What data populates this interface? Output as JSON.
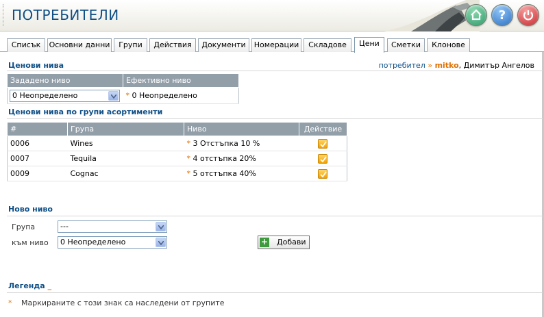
{
  "header": {
    "title": "ПОТРЕБИТЕЛИ",
    "buttons": [
      {
        "name": "home-icon"
      },
      {
        "name": "help-icon"
      },
      {
        "name": "power-icon"
      }
    ]
  },
  "tabs": [
    {
      "label": "Списък",
      "active": false
    },
    {
      "label": "Основни данни",
      "active": false
    },
    {
      "label": "Групи",
      "active": false
    },
    {
      "label": "Действия",
      "active": false
    },
    {
      "label": "Документи",
      "active": false
    },
    {
      "label": "Номерации",
      "active": false
    },
    {
      "label": "Складове",
      "active": false
    },
    {
      "label": "Цени",
      "active": true
    },
    {
      "label": "Сметки",
      "active": false
    },
    {
      "label": "Клонове",
      "active": false
    }
  ],
  "user": {
    "prefix": "потребител",
    "sep": "»",
    "login": "mitko",
    "full_name": ", Димитър Ангелов"
  },
  "price_levels": {
    "title": "Ценови нива",
    "col_set": "Зададено ниво",
    "col_effective": "Ефективно ниво",
    "set_value": "0 Неопределено",
    "effective_value": "0 Неопределено"
  },
  "group_levels": {
    "title": "Ценови нива по групи асортименти",
    "columns": [
      "#",
      "Група",
      "Ниво",
      "Действие"
    ],
    "rows": [
      {
        "id": "0006",
        "group": "Wines",
        "level": "3 Отстъпка 10 %"
      },
      {
        "id": "0007",
        "group": "Tequila",
        "level": "4 отстъпка 20%"
      },
      {
        "id": "0009",
        "group": "Cognac",
        "level": "5 отстъпка 40%"
      }
    ]
  },
  "new_level": {
    "title": "Ново ниво",
    "group_label": "Група",
    "group_value": "---",
    "level_label": "към ниво",
    "level_value": "0 Неопределено",
    "add_label": "Добави"
  },
  "legend": {
    "title": "Легенда",
    "underscore": "_",
    "star": "*",
    "text": "Маркираните с този знак са наследени от групите"
  },
  "colors": {
    "accent": "#0f4f86",
    "orange": "#e07000",
    "table_header": "#929ea8"
  }
}
